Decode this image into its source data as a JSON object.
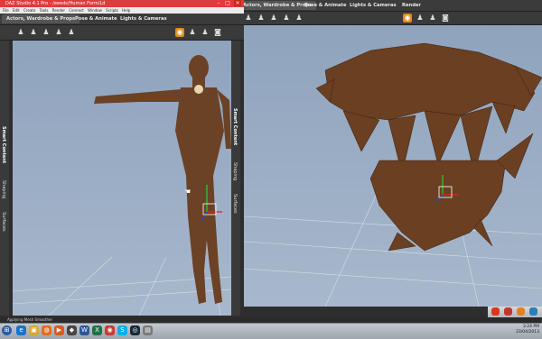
{
  "app": {
    "title": "DAZ Studio 4.1 Pro - /eeeds/Human Form/Ld",
    "menu": [
      "File",
      "Edit",
      "Create",
      "Tools",
      "Render",
      "Connect",
      "Window",
      "Scripts",
      "Help"
    ]
  },
  "left": {
    "tabs": [
      "Actors, Wardrobe & Props",
      "Pose & Animate",
      "Lights & Cameras"
    ],
    "side_labels": [
      "Smart Content",
      "Shaping",
      "Surfaces"
    ]
  },
  "right": {
    "tabs": [
      "Actors, Wardrobe & Props",
      "Pose & Animate",
      "Lights & Cameras",
      "Render"
    ],
    "side_labels": [
      "Smart Content",
      "Shaping",
      "Surfaces"
    ]
  },
  "status": {
    "text": "Applying Mesh Smoother"
  },
  "taskbar": {
    "clock_time": "3:24 PM",
    "clock_date": "23/04/2013",
    "apps": [
      "start",
      "ie",
      "folder",
      "firefox",
      "wmp",
      "daz",
      "word",
      "excel",
      "chrome",
      "skype",
      "steam",
      "misc"
    ]
  },
  "colors": {
    "accent": "#e08b1a",
    "titlebar": "#e03b3b",
    "viewport": "#9fb0c6",
    "skin": "#6b4226"
  }
}
